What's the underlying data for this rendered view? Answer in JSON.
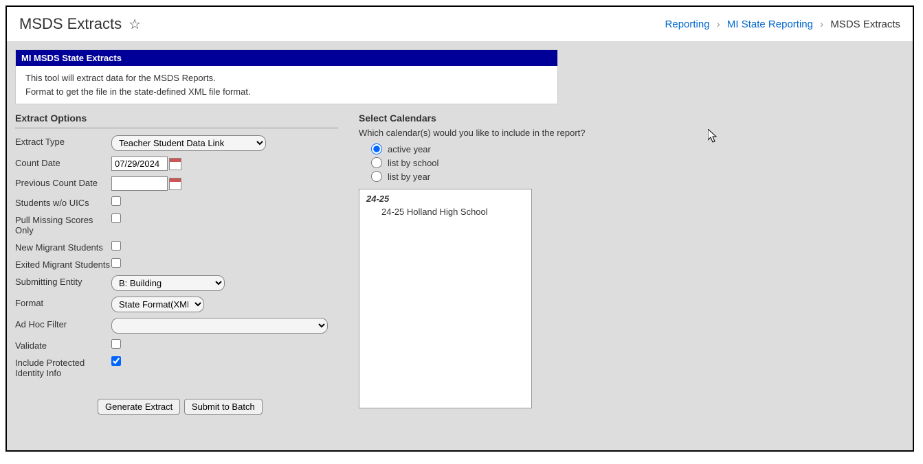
{
  "header": {
    "title": "MSDS Extracts",
    "breadcrumb": {
      "items": [
        {
          "label": "Reporting",
          "link": true
        },
        {
          "label": "MI State Reporting",
          "link": true
        },
        {
          "label": "MSDS Extracts",
          "link": false
        }
      ]
    }
  },
  "panel": {
    "title": "MI MSDS State Extracts",
    "line1": "This tool will extract data for the MSDS Reports.",
    "line2": "Format to get the file in the state-defined XML file format."
  },
  "form": {
    "section_title": "Extract Options",
    "extract_type": {
      "label": "Extract Type",
      "value": "Teacher Student Data Link"
    },
    "count_date": {
      "label": "Count Date",
      "value": "07/29/2024"
    },
    "prev_count_date": {
      "label": "Previous Count Date",
      "value": ""
    },
    "students_wo_uics": {
      "label": "Students w/o UICs",
      "checked": false
    },
    "pull_missing": {
      "label": "Pull Missing Scores Only",
      "checked": false
    },
    "new_migrant": {
      "label": "New Migrant Students",
      "checked": false
    },
    "exited_migrant": {
      "label": "Exited Migrant Students",
      "checked": false
    },
    "submitting_entity": {
      "label": "Submitting Entity",
      "value": "B: Building"
    },
    "format": {
      "label": "Format",
      "value": "State Format(XML)"
    },
    "adhoc": {
      "label": "Ad Hoc Filter",
      "value": ""
    },
    "validate": {
      "label": "Validate",
      "checked": false
    },
    "include_protected": {
      "label": "Include Protected Identity Info",
      "checked": true
    },
    "buttons": {
      "generate": "Generate Extract",
      "submit": "Submit to Batch"
    }
  },
  "calendars": {
    "title": "Select Calendars",
    "help": "Which calendar(s) would you like to include in the report?",
    "options": {
      "active_year": "active year",
      "by_school": "list by school",
      "by_year": "list by year"
    },
    "selected": "active_year",
    "list": {
      "year": "24-25",
      "school": "24-25 Holland High School"
    }
  }
}
